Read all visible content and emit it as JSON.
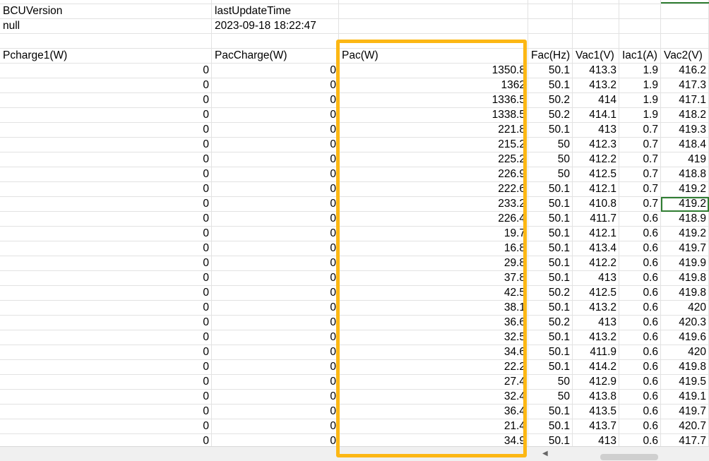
{
  "spreadsheet": {
    "header_rows": [
      {
        "a": "BCUVersion",
        "b": "lastUpdateTime"
      },
      {
        "a": "null",
        "b": "2023-09-18 18:22:47"
      }
    ],
    "columns": [
      "Pcharge1(W)",
      "PacCharge(W)",
      "Pac(W)",
      "Fac(Hz)",
      "Vac1(V)",
      "Iac1(A)",
      "Vac2(V)"
    ],
    "rows": [
      [
        "0",
        "0",
        "1350.8",
        "50.1",
        "413.3",
        "1.9",
        "416.2"
      ],
      [
        "0",
        "0",
        "1362",
        "50.1",
        "413.2",
        "1.9",
        "417.3"
      ],
      [
        "0",
        "0",
        "1336.5",
        "50.2",
        "414",
        "1.9",
        "417.1"
      ],
      [
        "0",
        "0",
        "1338.5",
        "50.2",
        "414.1",
        "1.9",
        "418.2"
      ],
      [
        "0",
        "0",
        "221.8",
        "50.1",
        "413",
        "0.7",
        "419.3"
      ],
      [
        "0",
        "0",
        "215.2",
        "50",
        "412.3",
        "0.7",
        "418.4"
      ],
      [
        "0",
        "0",
        "225.2",
        "50",
        "412.2",
        "0.7",
        "419"
      ],
      [
        "0",
        "0",
        "226.9",
        "50",
        "412.5",
        "0.7",
        "418.8"
      ],
      [
        "0",
        "0",
        "222.6",
        "50.1",
        "412.1",
        "0.7",
        "419.2"
      ],
      [
        "0",
        "0",
        "233.2",
        "50.1",
        "410.8",
        "0.7",
        "419.2"
      ],
      [
        "0",
        "0",
        "226.4",
        "50.1",
        "411.7",
        "0.6",
        "418.9"
      ],
      [
        "0",
        "0",
        "19.7",
        "50.1",
        "412.1",
        "0.6",
        "419.2"
      ],
      [
        "0",
        "0",
        "16.8",
        "50.1",
        "413.4",
        "0.6",
        "419.7"
      ],
      [
        "0",
        "0",
        "29.8",
        "50.1",
        "412.2",
        "0.6",
        "419.9"
      ],
      [
        "0",
        "0",
        "37.8",
        "50.1",
        "413",
        "0.6",
        "419.8"
      ],
      [
        "0",
        "0",
        "42.5",
        "50.2",
        "412.5",
        "0.6",
        "419.8"
      ],
      [
        "0",
        "0",
        "38.1",
        "50.1",
        "413.2",
        "0.6",
        "420"
      ],
      [
        "0",
        "0",
        "36.6",
        "50.2",
        "413",
        "0.6",
        "420.3"
      ],
      [
        "0",
        "0",
        "32.5",
        "50.1",
        "413.2",
        "0.6",
        "419.6"
      ],
      [
        "0",
        "0",
        "34.6",
        "50.1",
        "411.9",
        "0.6",
        "420"
      ],
      [
        "0",
        "0",
        "22.2",
        "50.1",
        "414.2",
        "0.6",
        "419.8"
      ],
      [
        "0",
        "0",
        "27.4",
        "50",
        "412.9",
        "0.6",
        "419.5"
      ],
      [
        "0",
        "0",
        "32.4",
        "50",
        "413.8",
        "0.6",
        "419.1"
      ],
      [
        "0",
        "0",
        "36.4",
        "50.1",
        "413.5",
        "0.6",
        "419.7"
      ],
      [
        "0",
        "0",
        "21.4",
        "50.1",
        "413.7",
        "0.6",
        "420.7"
      ],
      [
        "0",
        "0",
        "34.9",
        "50.1",
        "413",
        "0.6",
        "417.7"
      ]
    ],
    "selected_cell": {
      "row": 9,
      "col": 6
    }
  },
  "highlight": {
    "target_column": "Pac(W)",
    "color": "#fcb714"
  },
  "colors": {
    "selection": "#2f7d32",
    "gridline": "#e2e2e2"
  },
  "icons": {
    "scroll_left": "triangle-left-icon"
  }
}
